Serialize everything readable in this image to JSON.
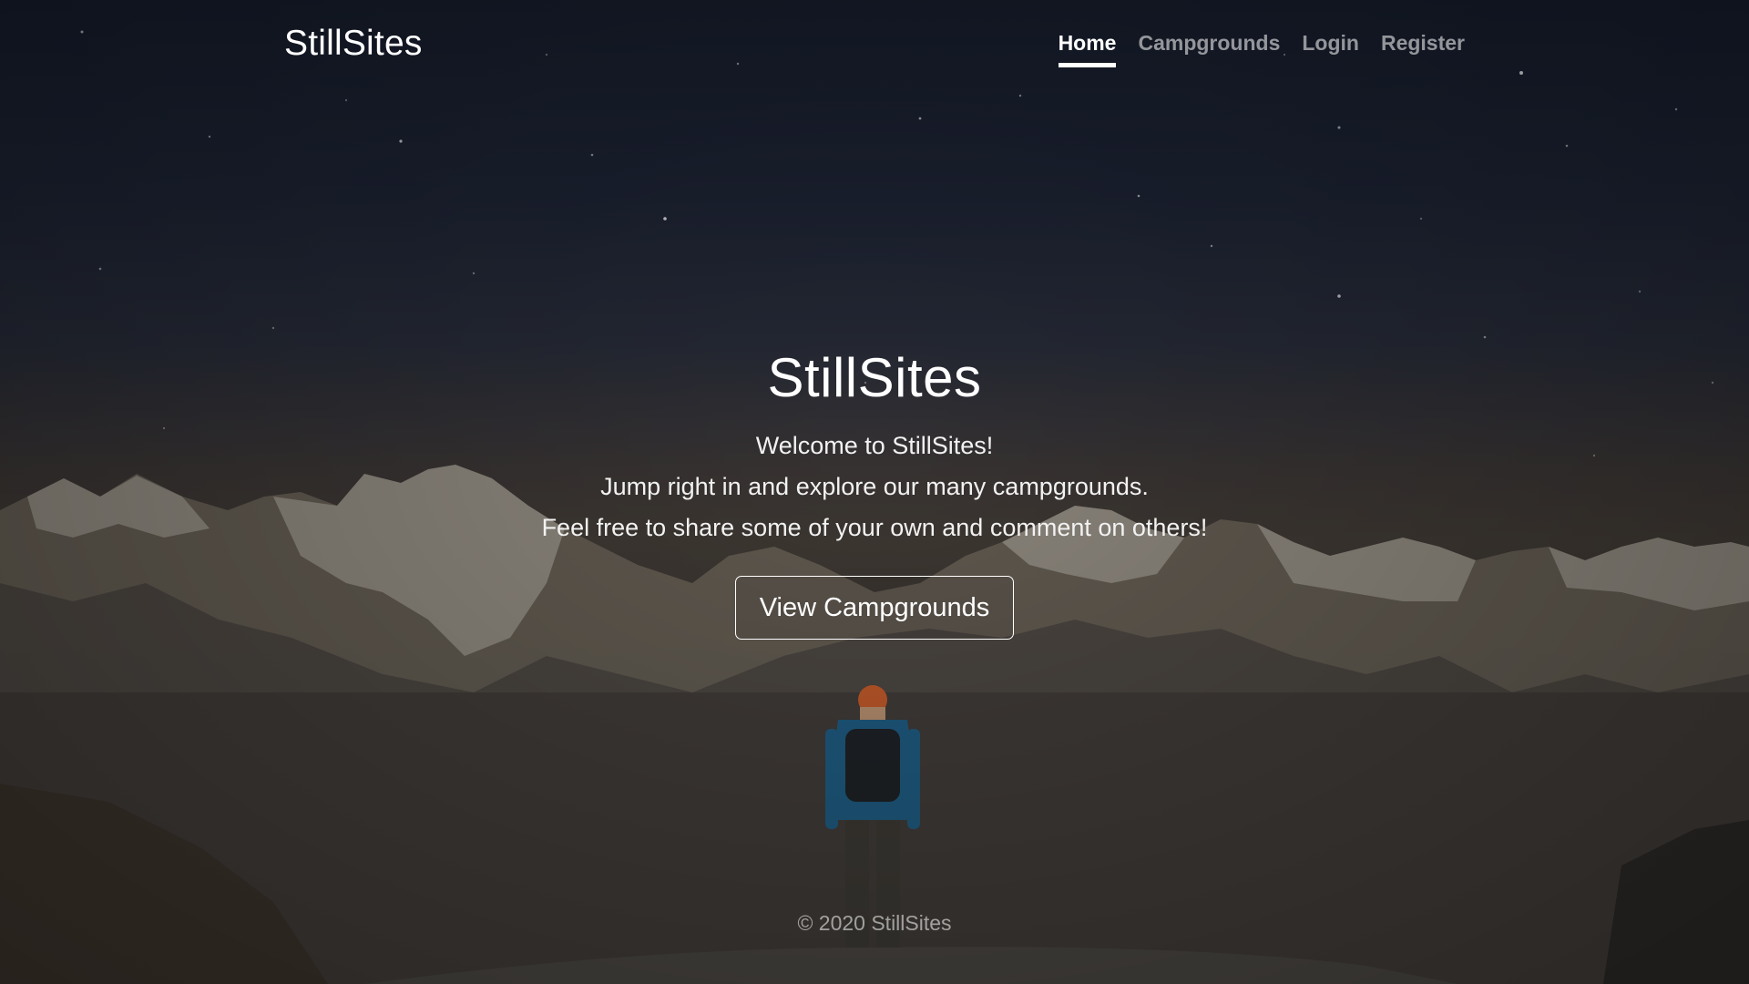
{
  "navbar": {
    "brand": "StillSites",
    "links": [
      {
        "label": "Home",
        "active": true
      },
      {
        "label": "Campgrounds",
        "active": false
      },
      {
        "label": "Login",
        "active": false
      },
      {
        "label": "Register",
        "active": false
      }
    ]
  },
  "hero": {
    "title": "StillSites",
    "lines": [
      "Welcome to StillSites!",
      "Jump right in and explore our many campgrounds.",
      "Feel free to share some of your own and comment on others!"
    ],
    "button_label": "View Campgrounds"
  },
  "footer": {
    "text": "© 2020 StillSites"
  },
  "colors": {
    "text": "#ffffff",
    "muted_link": "#8c8c8c",
    "sky": "#1c2232",
    "horizon": "#403a34"
  }
}
